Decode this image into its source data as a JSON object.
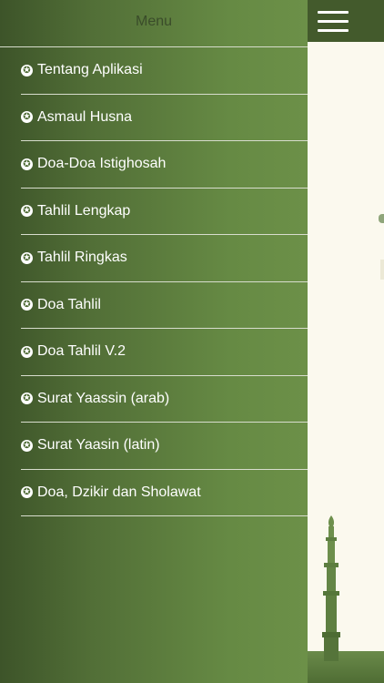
{
  "drawer": {
    "title": "Menu",
    "items": [
      {
        "label": "Tentang Aplikasi",
        "icon": "star-circle-icon"
      },
      {
        "label": "Asmaul Husna",
        "icon": "star-circle-icon"
      },
      {
        "label": "Doa-Doa Istighosah",
        "icon": "star-circle-icon"
      },
      {
        "label": "Tahlil Lengkap",
        "icon": "star-circle-icon"
      },
      {
        "label": "Tahlil Ringkas",
        "icon": "star-circle-icon"
      },
      {
        "label": "Doa Tahlil",
        "icon": "star-circle-icon"
      },
      {
        "label": "Doa Tahlil V.2",
        "icon": "star-circle-icon"
      },
      {
        "label": "Surat Yaassin (arab)",
        "icon": "star-circle-icon"
      },
      {
        "label": "Surat Yaasin (latin)",
        "icon": "star-circle-icon"
      },
      {
        "label": "Doa, Dzikir dan Sholawat",
        "icon": "star-circle-icon"
      }
    ]
  },
  "topbar": {
    "menu_icon": "hamburger-menu-icon"
  },
  "colors": {
    "drawer_dark": "#3d5429",
    "drawer_light": "#6c9048",
    "topbar": "#435a2c",
    "background": "#fbf9ee",
    "divider": "#d8ddce"
  }
}
